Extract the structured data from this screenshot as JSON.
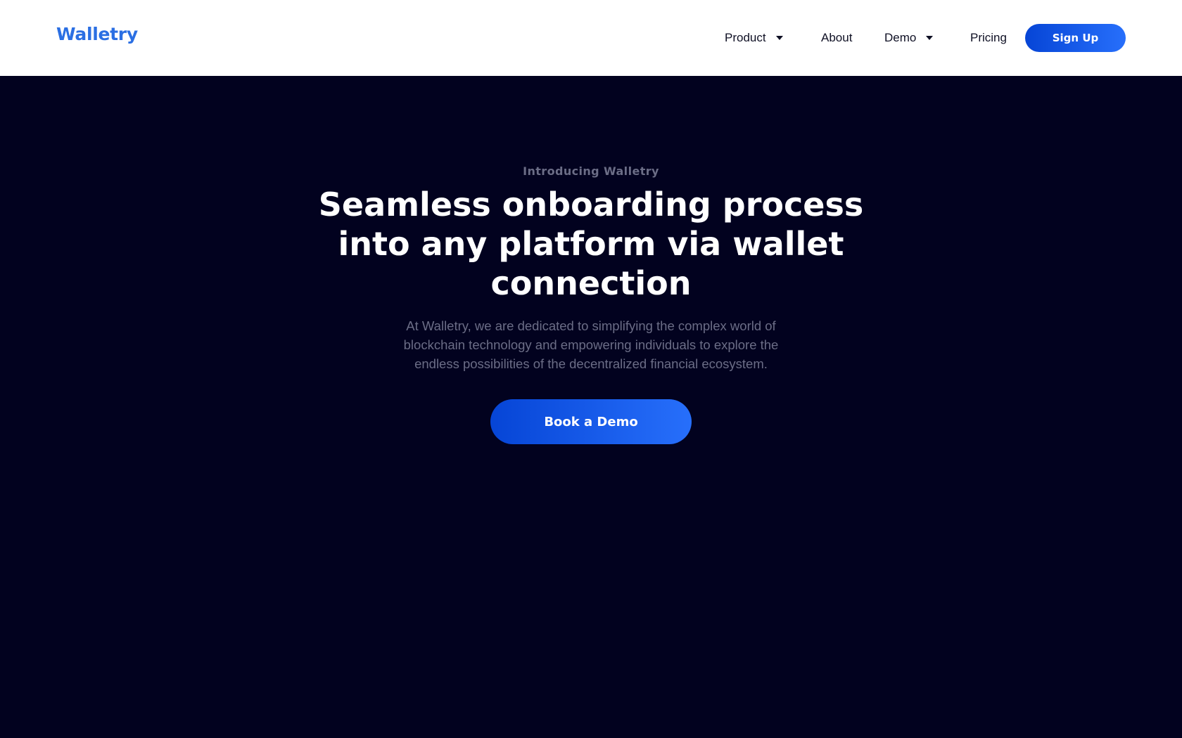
{
  "brand": {
    "name": "Walletry",
    "color": "#2b6fe3"
  },
  "nav": {
    "items": [
      {
        "label": "Product",
        "dropdown": true
      },
      {
        "label": "About",
        "dropdown": false
      },
      {
        "label": "Demo",
        "dropdown": true
      },
      {
        "label": "Pricing",
        "dropdown": false
      }
    ],
    "signup_label": "Sign Up",
    "dropdown_icon": "caret-down-icon"
  },
  "hero": {
    "eyebrow": "Introducing Walletry",
    "headline": "Seamless onboarding process into any platform via wallet connection",
    "subtext": "At Walletry, we are dedicated to simplifying the complex world of blockchain technology and empowering individuals to explore the endless possibilities of the decentralized financial ecosystem.",
    "cta_label": "Book a Demo"
  },
  "colors": {
    "background": "#02021f",
    "navbar": "#ffffff",
    "button_gradient_start": "#0645d6",
    "button_gradient_end": "#276ffb",
    "muted_text": "#6b6d86"
  }
}
